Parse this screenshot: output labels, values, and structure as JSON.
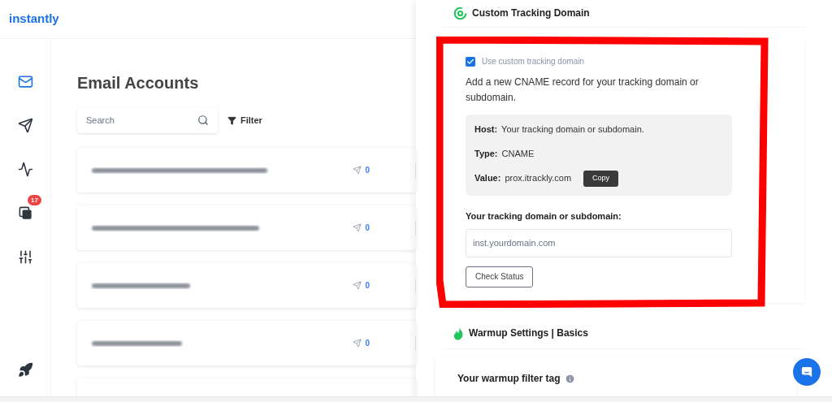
{
  "logo": "instantly",
  "sidebar": {
    "items": [
      {
        "kind": "mail",
        "selected": true
      },
      {
        "kind": "send",
        "selected": false
      },
      {
        "kind": "chart",
        "selected": false
      },
      {
        "kind": "inbox",
        "selected": false,
        "badge": "17"
      },
      {
        "kind": "sliders",
        "selected": false
      },
      {
        "kind": "rocket",
        "selected": false
      }
    ]
  },
  "page_title": "Email Accounts",
  "search": {
    "placeholder": "Search"
  },
  "filter_button": "Filter",
  "accounts": [
    {
      "sent": "0"
    },
    {
      "sent": "0"
    },
    {
      "sent": "0"
    },
    {
      "sent": "0"
    }
  ],
  "tracking": {
    "title": "Custom Tracking Domain",
    "checkbox": {
      "label": "Use custom tracking domain",
      "checked": true
    },
    "description": "Add a new CNAME record for your tracking domain or subdomain.",
    "records": [
      {
        "label": "Host:",
        "value": "Your tracking domain or subdomain."
      },
      {
        "label": "Type:",
        "value": "CNAME"
      },
      {
        "label": "Value:",
        "value": "prox.itrackly.com",
        "action": "Copy"
      }
    ],
    "field_label": "Your tracking domain or subdomain:",
    "field": {
      "placeholder": "inst.yourdomain.com"
    },
    "check_button": "Check Status"
  },
  "warmup": {
    "title": "Warmup Settings | Basics",
    "filter_tag_label": "Your warmup filter tag"
  }
}
